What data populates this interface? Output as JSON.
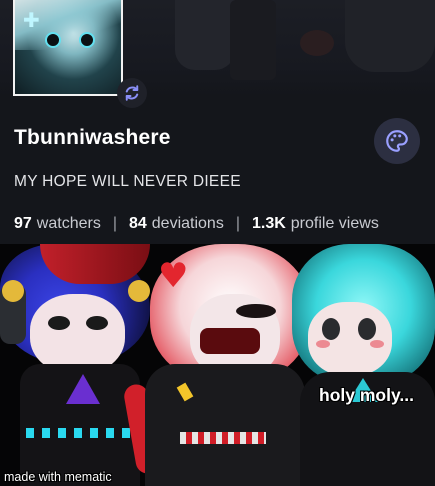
{
  "profile": {
    "username": "Tbunniwashere",
    "tagline": "MY HOPE WILL NEVER DIEEE",
    "stats": [
      {
        "value": "97",
        "label": "watchers"
      },
      {
        "value": "84",
        "label": "deviations"
      },
      {
        "value": "1.3K",
        "label": "profile views"
      }
    ],
    "separator": "|",
    "icons": {
      "avatar_badge": "sync-icon",
      "theme_button": "palette-icon"
    }
  },
  "image": {
    "caption": "holy moly...",
    "watermark": "made with mematic"
  },
  "colors": {
    "background": "#14161b",
    "accent": "#8a8ff7",
    "text_primary": "#ffffff",
    "text_secondary": "#c9cbd1"
  }
}
